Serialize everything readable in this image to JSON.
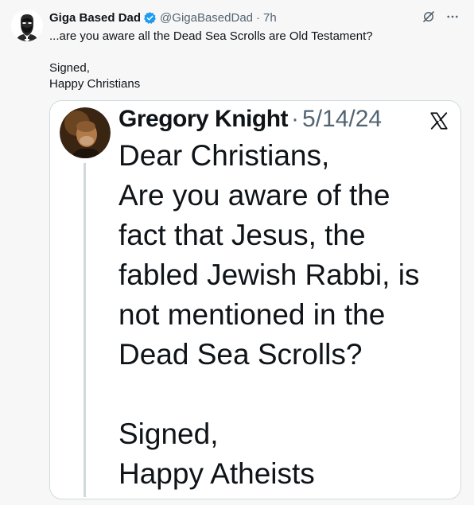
{
  "author": {
    "display_name": "Giga Based Dad",
    "handle": "@GigaBasedDad",
    "separator": "·",
    "time": "7h"
  },
  "tweet": {
    "line1": "...are you aware all the Dead Sea Scrolls are Old Testament?",
    "line2": "Signed,",
    "line3": "Happy Christians"
  },
  "embedded": {
    "name": "Gregory Knight",
    "separator": "·",
    "date": "5/14/24",
    "lines": [
      "Dear Christians,",
      "Are you aware of the",
      "fact that Jesus, the",
      "fabled Jewish Rabbi, is",
      "not mentioned in the",
      "Dead Sea Scrolls?",
      "Signed,",
      "Happy Atheists"
    ]
  },
  "icons": {
    "verified": "verified-badge-icon",
    "grok": "grok-icon",
    "more": "more-icon",
    "x_logo": "x-logo-icon"
  },
  "colors": {
    "verified": "#1d9bf0",
    "secondary_text": "#536471",
    "border": "#cfd9de"
  }
}
